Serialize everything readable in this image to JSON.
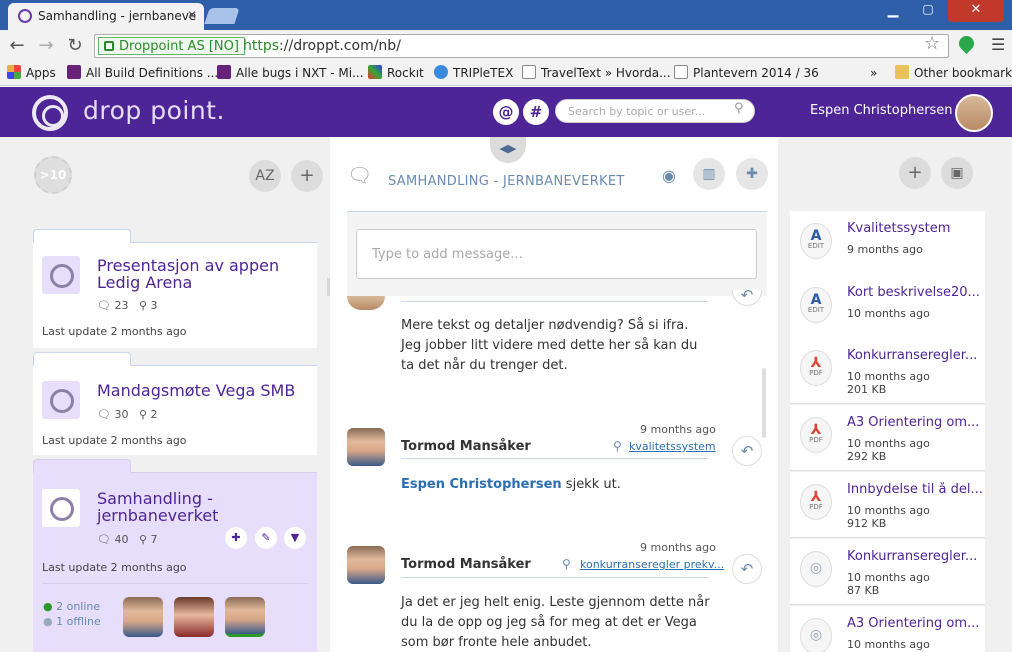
{
  "browser": {
    "tab_title": "Samhandling - jernbaneve",
    "ev_label": "Droppoint AS [NO]",
    "url_https": "https",
    "url_rest": "://droppt.com/nb/",
    "bookmarks": [
      "Apps",
      "All Build Definitions ...",
      "Alle bugs i NXT - Mi...",
      "Rockıt",
      "TRIPleTEX",
      "TravelText » Hvorda...",
      "Plantevern 2014 / 36",
      "»",
      "Other bookmarks"
    ]
  },
  "header": {
    "logo_text": "drop point.",
    "at_symbol": "@",
    "hash_symbol": "#",
    "search_placeholder": "Search by topic or user...",
    "user_name": "Espen Christophersen"
  },
  "left": {
    "more_count": ">10",
    "sort_label": "AZ",
    "add_label": "+",
    "cards": [
      {
        "title": "Presentasjon av appen Ledig Arena",
        "comments": "23",
        "pins": "3",
        "updated": "Last update 2 months ago"
      },
      {
        "title": "Mandagsmøte Vega SMB",
        "comments": "30",
        "pins": "2",
        "updated": "Last update 2 months ago"
      },
      {
        "title": "Samhandling - jernbaneverket",
        "comments": "40",
        "pins": "7",
        "updated": "Last update 2 months ago"
      }
    ],
    "online": "2 online",
    "offline": "1 offline"
  },
  "center": {
    "title": "SAMHANDLING - JERNBANEVERKET",
    "message_placeholder": "Type to add message...",
    "messages": [
      {
        "text": "Mere tekst og detaljer nødvendig? Så si ifra. Jeg jobber litt videre med dette her så kan du ta det når du trenger det."
      },
      {
        "time": "9 months ago",
        "name": "Tormod Mansåker",
        "tag": "kvalitetssystem",
        "mention": "Espen Christophersen",
        "text": " sjekk ut."
      },
      {
        "time": "9 months ago",
        "name": "Tormod Mansåker",
        "tag": "konkurranseregler prekv...",
        "text": "Ja det er jeg helt enig. Leste gjennom dette når du la de opp og jeg så for meg at det er Vega som bør fronte hele anbudet."
      }
    ]
  },
  "right": {
    "files": [
      {
        "name": "Kvalitetssystem",
        "type": "EDIT",
        "glyph": "A",
        "time": "9 months ago",
        "size": ""
      },
      {
        "name": "Kort beskrivelse20...",
        "type": "EDIT",
        "glyph": "A",
        "time": "10 months ago",
        "size": ""
      },
      {
        "name": "Konkurranseregler...",
        "type": "PDF",
        "glyph": "⅄",
        "time": "10 months ago",
        "size": "201 KB"
      },
      {
        "name": "A3 Orientering om...",
        "type": "PDF",
        "glyph": "⅄",
        "time": "10 months ago",
        "size": "292 KB"
      },
      {
        "name": "Innbydelse til å del...",
        "type": "PDF",
        "glyph": "⅄",
        "time": "10 months ago",
        "size": "912 KB"
      },
      {
        "name": "Konkurranseregler...",
        "type": "",
        "glyph": "◎",
        "time": "10 months ago",
        "size": "87 KB"
      },
      {
        "name": "A3 Orientering om...",
        "type": "",
        "glyph": "◎",
        "time": "10 months ago",
        "size": ""
      }
    ]
  },
  "colors": {
    "brand": "#4d2596",
    "selected": "#e6defa",
    "link": "#2a6fb3"
  }
}
